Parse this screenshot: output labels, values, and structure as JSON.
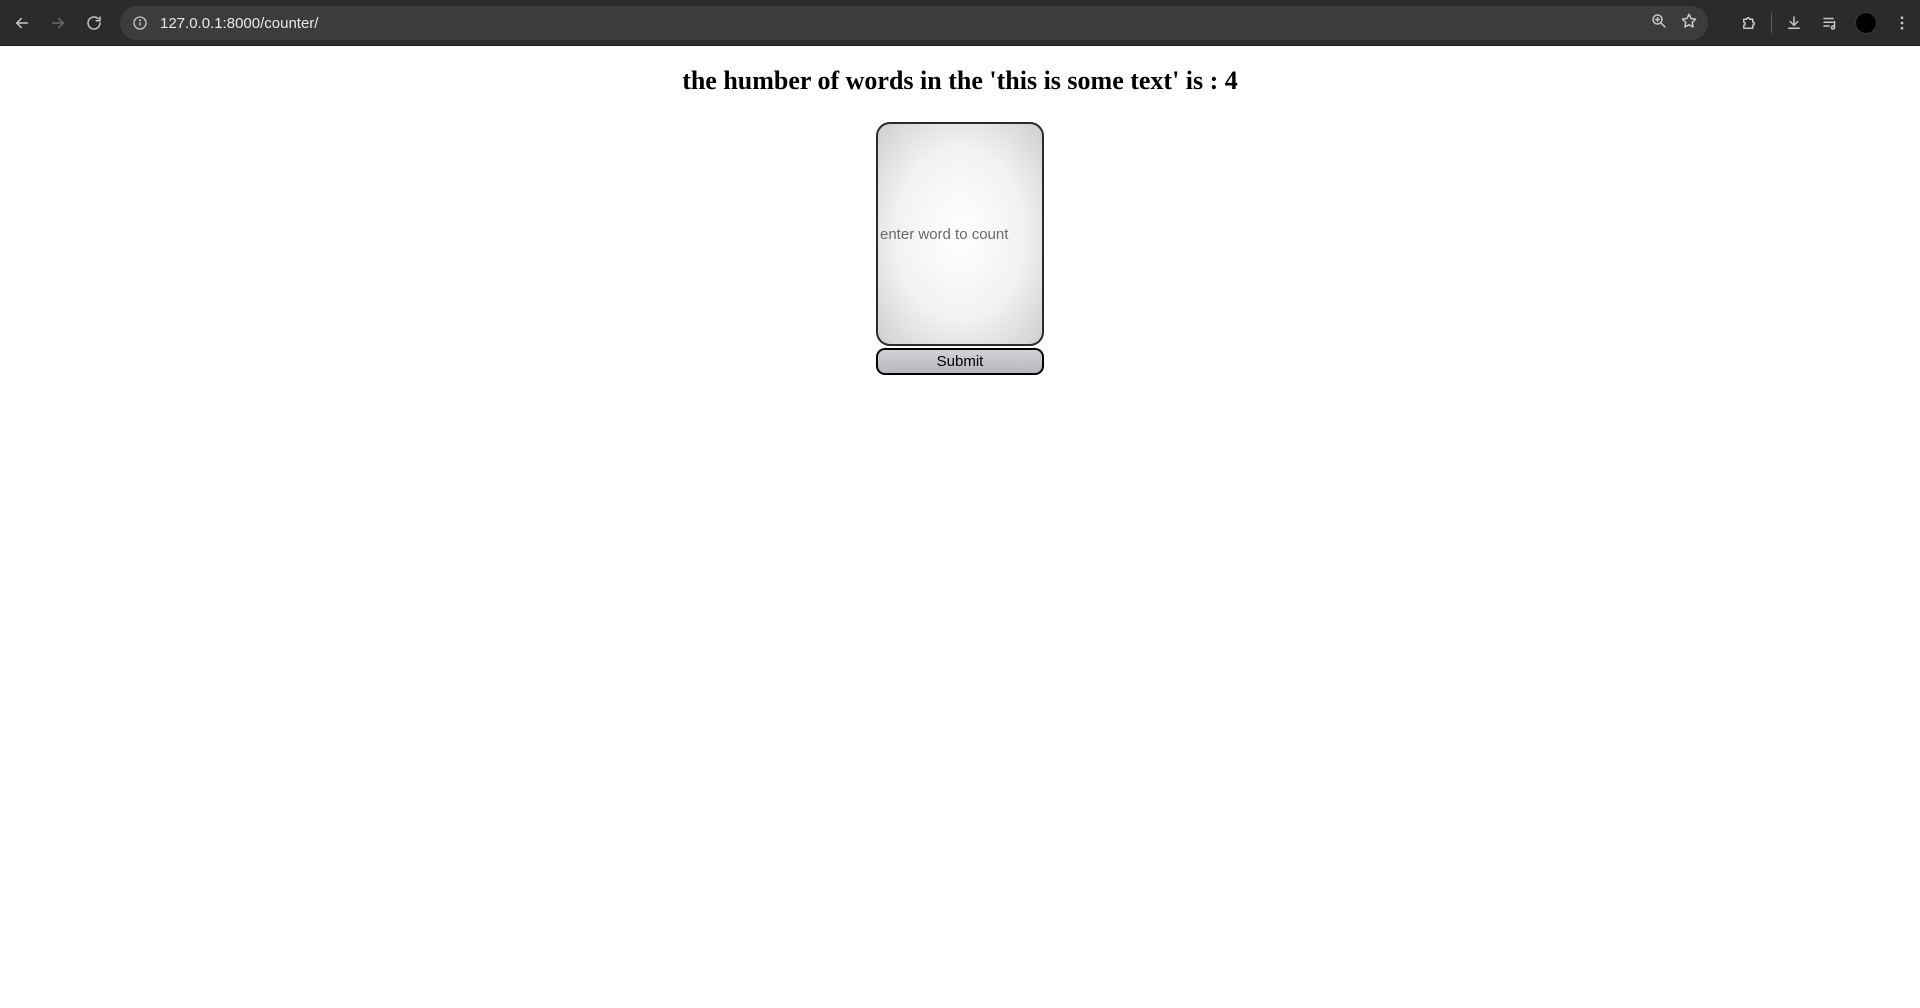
{
  "browser": {
    "url": "127.0.0.1:8000/counter/",
    "icons": {
      "back": "back-arrow-icon",
      "forward": "forward-arrow-icon",
      "reload": "reload-icon",
      "site_info": "site-info-icon",
      "zoom": "zoom-icon",
      "bookmark": "star-icon",
      "extensions": "puzzle-icon",
      "downloads": "download-icon",
      "media": "media-controls-icon",
      "profile": "avatar",
      "menu": "kebab-menu-icon"
    }
  },
  "page": {
    "heading": "the humber of words in the 'this is some text' is : 4",
    "input": {
      "placeholder": "enter word to count",
      "value": ""
    },
    "submit_label": "Submit"
  }
}
